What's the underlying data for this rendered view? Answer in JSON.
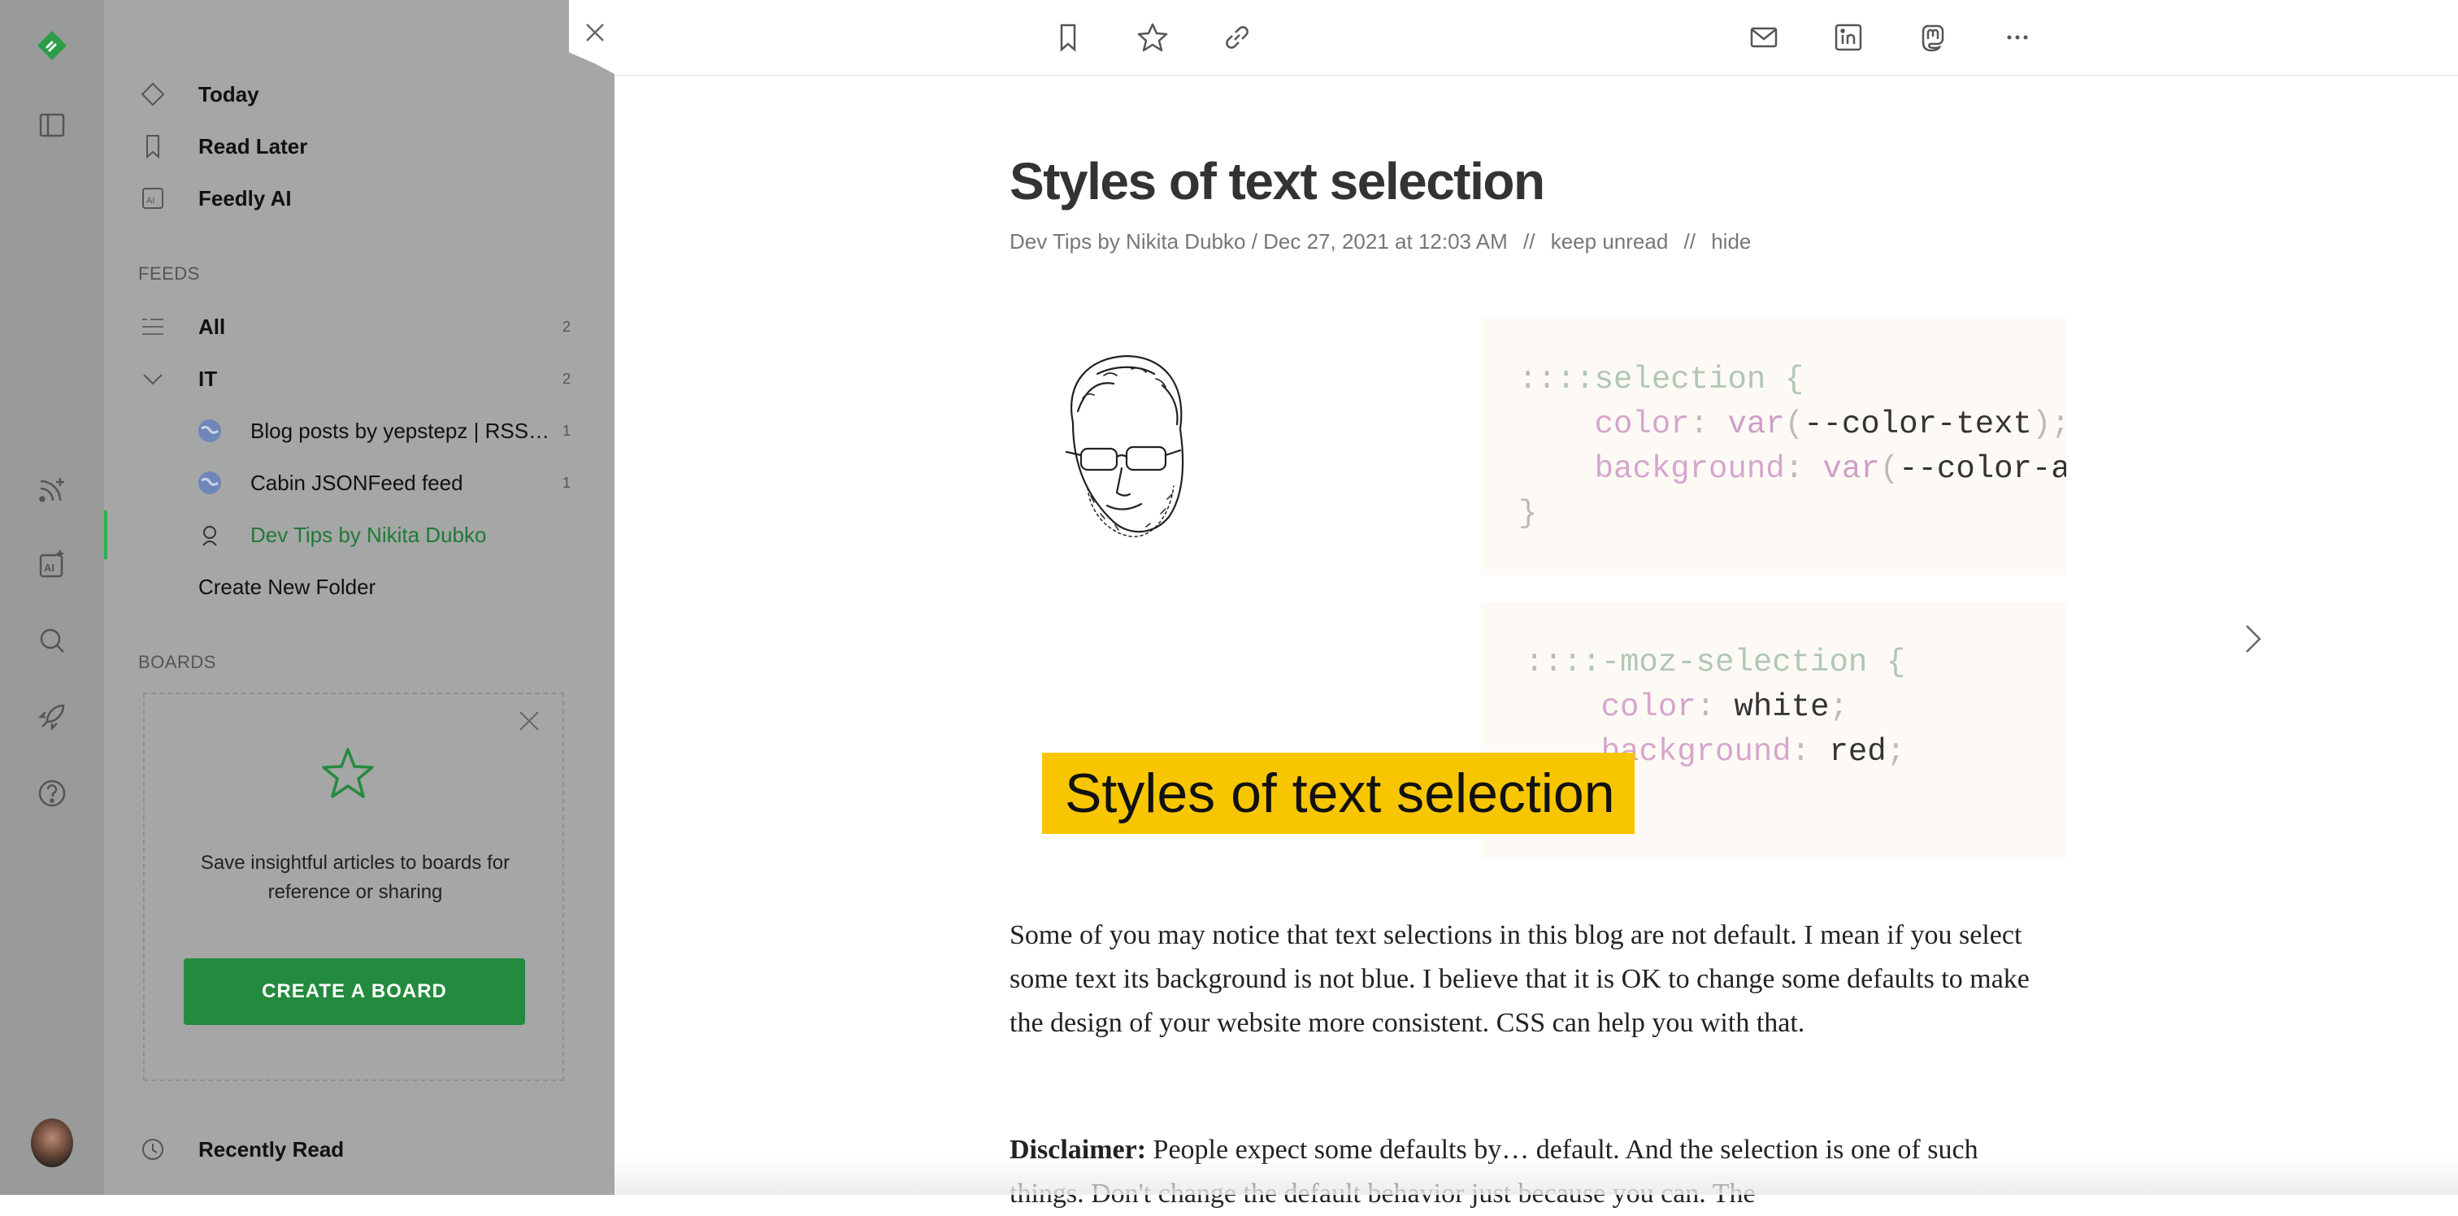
{
  "sidebar": {
    "nav": [
      {
        "label": "Today"
      },
      {
        "label": "Read Later"
      },
      {
        "label": "Feedly AI"
      }
    ],
    "feeds_header": "FEEDS",
    "feeds": {
      "all": {
        "label": "All",
        "count": "2"
      },
      "folder": {
        "label": "IT",
        "count": "2"
      },
      "items": [
        {
          "label": "Blog posts by yepstepz | RSS Feed",
          "count": "1"
        },
        {
          "label": "Cabin JSONFeed feed",
          "count": "1"
        },
        {
          "label": "Dev Tips by Nikita Dubko",
          "count": ""
        }
      ],
      "create_folder": "Create New Folder"
    },
    "boards_header": "BOARDS",
    "boards_card": {
      "text": "Save insightful articles to boards for reference or sharing",
      "button": "CREATE A BOARD"
    },
    "recently_read": "Recently Read",
    "accent": "#2bb24c"
  },
  "article": {
    "title": "Styles of text selection",
    "meta": {
      "source": "Dev Tips by Nikita Dubko",
      "date": "Dec 27, 2021 at 12:03 AM",
      "sep1": "//",
      "keep_unread": "keep unread",
      "sep2": "//",
      "hide": "hide"
    },
    "hero": {
      "label": "Styles of text selection",
      "label_bg": "#f7c600",
      "code1": {
        "selector": "::selection",
        "brace_open": "{",
        "prop1": "color",
        "val1_fn": "var",
        "val1_arg": "--color-text",
        "prop2": "background",
        "val2_fn": "var",
        "val2_arg": "--color-acc",
        "brace_close": "}"
      },
      "code2": {
        "selector": "::-moz-selection",
        "brace_open": "{",
        "prop1": "color",
        "val1": "white",
        "prop2": "background",
        "val2": "red"
      }
    },
    "paragraph1": "Some of you may notice that text selections in this blog are not default. I mean if you select some text its background is not blue. I believe that it is OK to change some defaults to make the design of your website more consistent. CSS can help you with that.",
    "paragraph2_bold": "Disclaimer:",
    "paragraph2": " People expect some defaults by… default. And the selection is one of such things. Don't change the default behavior just because you can. The"
  }
}
